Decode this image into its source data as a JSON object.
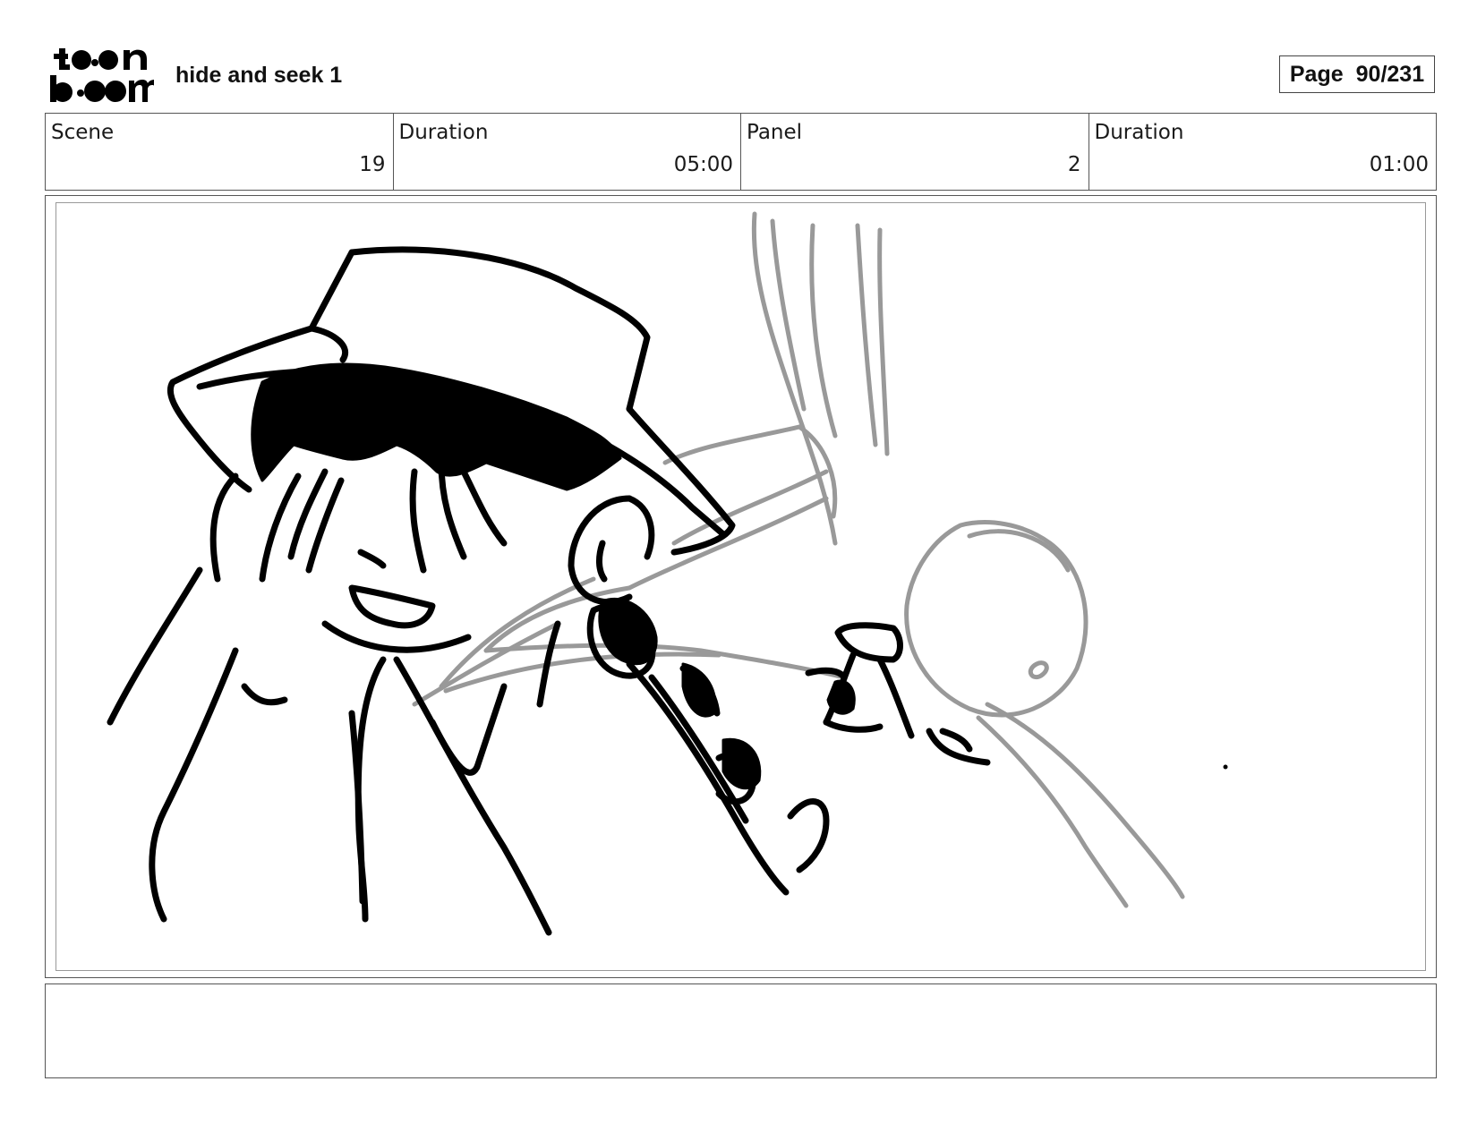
{
  "header": {
    "logo_text": "toonboom",
    "project_title": "hide and seek 1",
    "page_label": "Page",
    "page_number": "90/231"
  },
  "info": {
    "scene_label": "Scene",
    "scene_value": "19",
    "scene_duration_label": "Duration",
    "scene_duration_value": "05:00",
    "panel_label": "Panel",
    "panel_value": "2",
    "panel_duration_label": "Duration",
    "panel_duration_value": "01:00"
  },
  "notes": {
    "text": ""
  }
}
